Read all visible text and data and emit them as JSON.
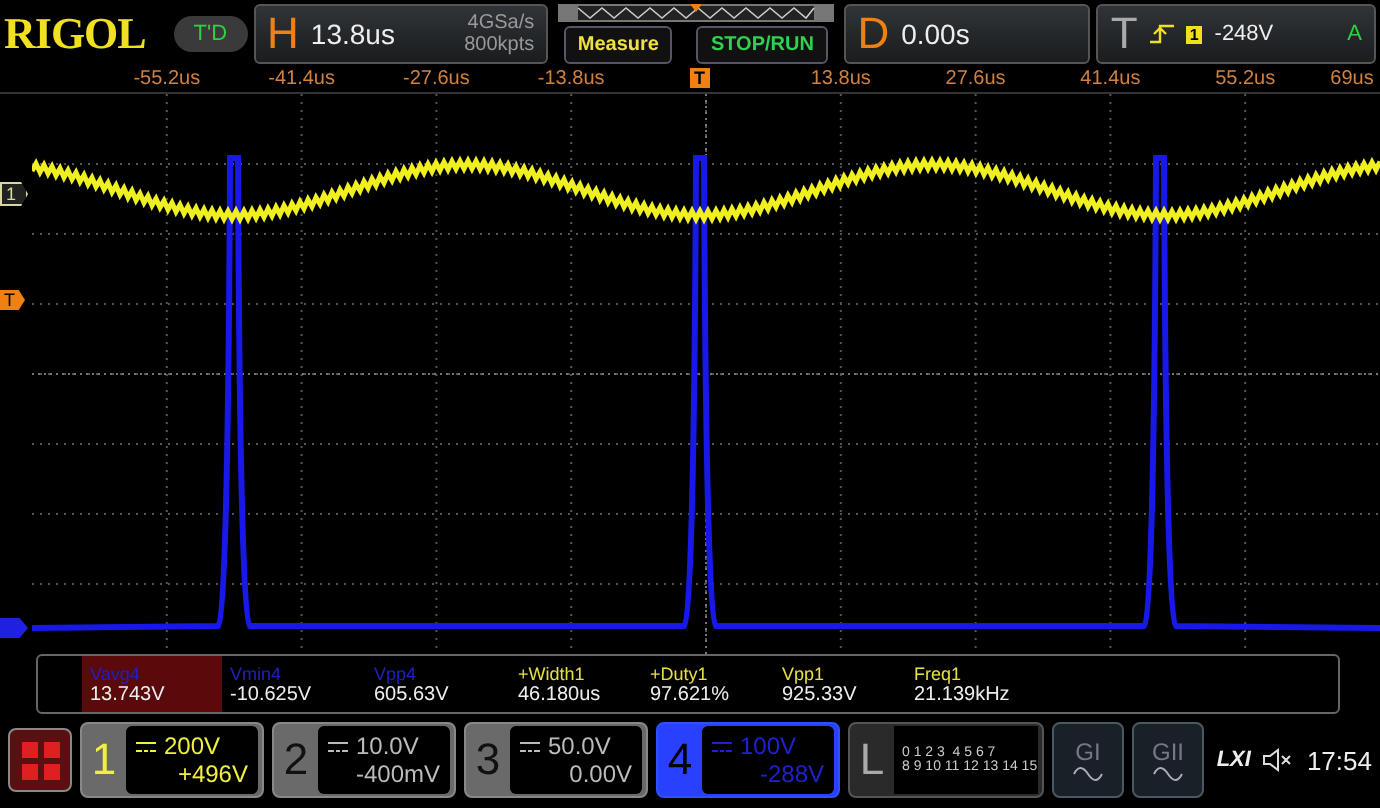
{
  "brand": {
    "logo": "RIGOL",
    "trigger_status": "T'D"
  },
  "horizontal": {
    "label": "H",
    "timebase": "13.8us",
    "sample_rate": "4GSa/s",
    "memory_depth": "800kpts"
  },
  "buttons": [
    {
      "label": "Measure",
      "color": "#f0e040"
    },
    {
      "label": "STOP/RUN",
      "color": "#30d050"
    }
  ],
  "delay": {
    "label": "D",
    "value": "0.00s"
  },
  "trigger": {
    "label": "T",
    "source": "1",
    "level": "-248V",
    "mode": "A"
  },
  "time_axis": [
    "-55.2us",
    "-41.4us",
    "-27.6us",
    "-13.8us",
    "13.8us",
    "27.6us",
    "41.4us",
    "55.2us",
    "69us"
  ],
  "trigger_position": {
    "label": "T"
  },
  "markers": [
    {
      "label": "1",
      "kind": "channel",
      "color": "#d8d8a0"
    },
    {
      "label": "T",
      "kind": "trigger",
      "color": "#f08010"
    }
  ],
  "measurements": [
    {
      "name": "Vavg4",
      "value": "13.743V",
      "color": "#2020c0",
      "selected": true
    },
    {
      "name": "Vmin4",
      "value": "-10.625V",
      "color": "#2020c0",
      "selected": false
    },
    {
      "name": "Vpp4",
      "value": "605.63V",
      "color": "#2020c0",
      "selected": false
    },
    {
      "name": "+Width1",
      "value": "46.180us",
      "color": "#e8e040",
      "selected": false
    },
    {
      "name": "+Duty1",
      "value": "97.621%",
      "color": "#e8e040",
      "selected": false
    },
    {
      "name": "Vpp1",
      "value": "925.33V",
      "color": "#e8e040",
      "selected": false
    },
    {
      "name": "Freq1",
      "value": "21.139kHz",
      "color": "#e8e040",
      "selected": false
    }
  ],
  "channels": [
    {
      "number": "1",
      "scale": "200V",
      "offset": "+496V",
      "on": true,
      "selected": false,
      "color": "#f0f040"
    },
    {
      "number": "2",
      "scale": "10.0V",
      "offset": "-400mV",
      "on": false,
      "selected": false,
      "color": "#bbbbbb"
    },
    {
      "number": "3",
      "scale": "50.0V",
      "offset": "0.00V",
      "on": false,
      "selected": false,
      "color": "#bbbbbb"
    },
    {
      "number": "4",
      "scale": "100V",
      "offset": "-288V",
      "on": true,
      "selected": true,
      "color": "#2020d0"
    }
  ],
  "logic": {
    "label": "L",
    "bits_top": "0 1 2 3  4 5 6 7",
    "bits_bottom": "8 9 10 11 12 13 14 15"
  },
  "generators": [
    "GI",
    "GII"
  ],
  "status": {
    "lxi": "LXI",
    "muted": true,
    "time": "17:54"
  }
}
